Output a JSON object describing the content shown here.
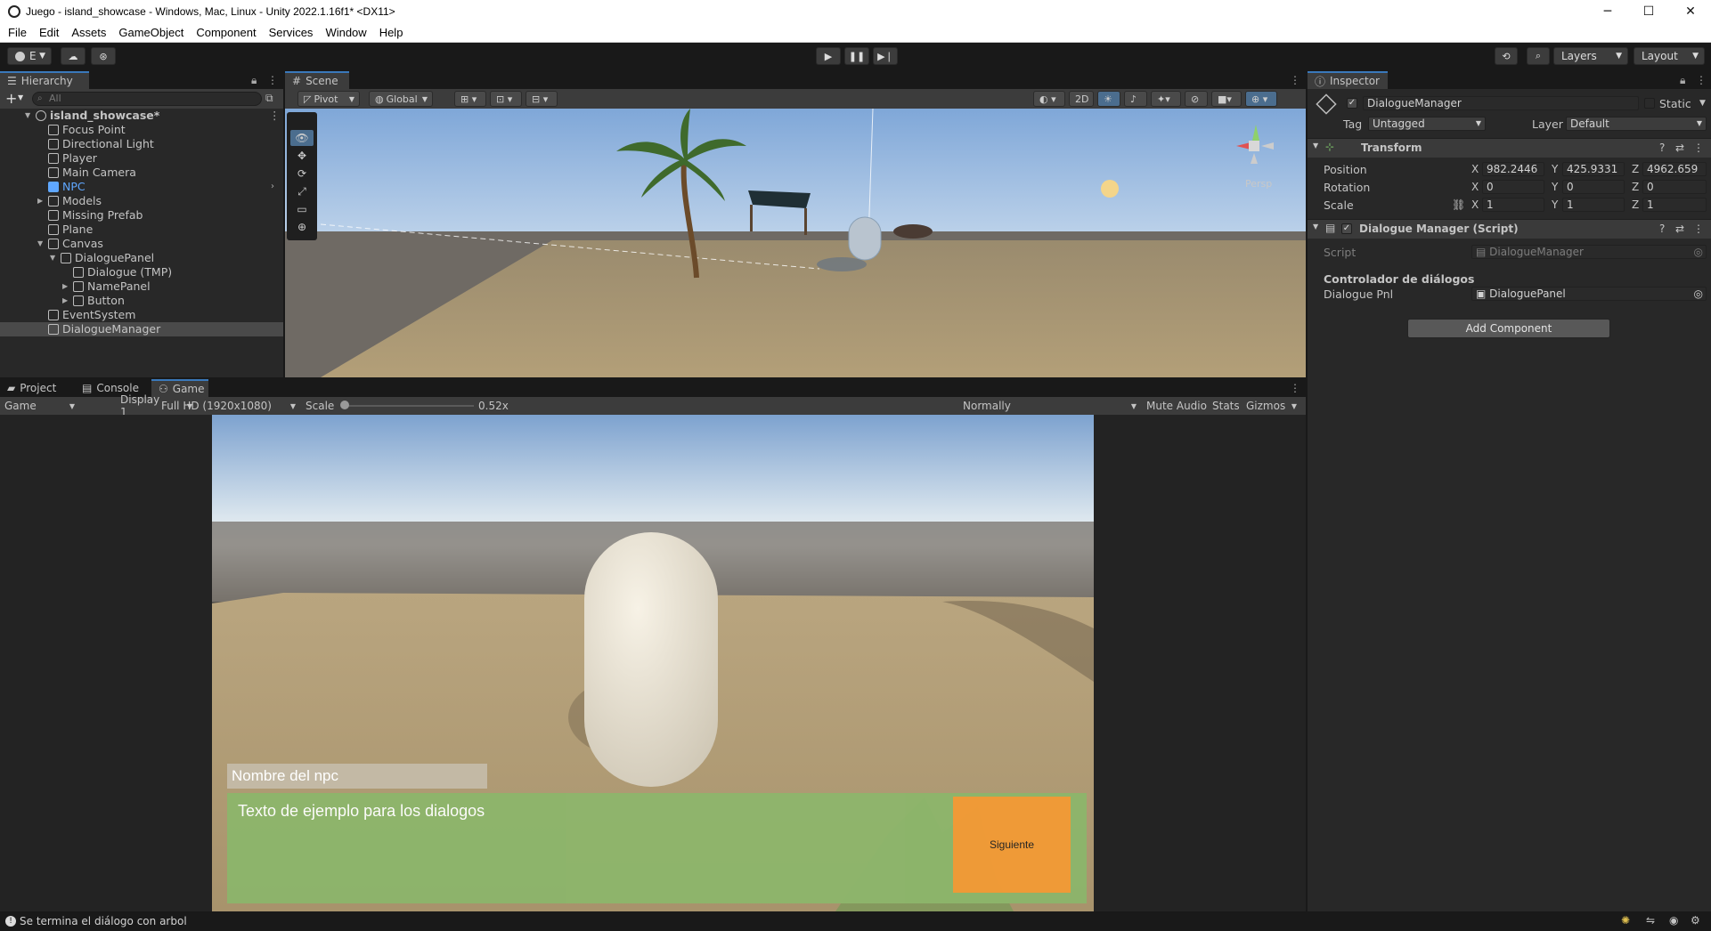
{
  "window": {
    "title": "Juego - island_showcase - Windows, Mac, Linux - Unity 2022.1.16f1* <DX11>",
    "controls": {
      "minimize": "─",
      "maximize": "☐",
      "close": "✕"
    }
  },
  "menu": [
    "File",
    "Edit",
    "Assets",
    "GameObject",
    "Component",
    "Services",
    "Window",
    "Help"
  ],
  "toolbar": {
    "account_label": "E",
    "layers_label": "Layers",
    "layout_label": "Layout"
  },
  "hierarchy": {
    "tab_label": "Hierarchy",
    "search_placeholder": "All",
    "items": [
      {
        "label": "island_showcase*",
        "depth": 0,
        "fold": "open",
        "kind": "scene"
      },
      {
        "label": "Focus Point",
        "depth": 1,
        "fold": "none",
        "kind": "object"
      },
      {
        "label": "Directional Light",
        "depth": 1,
        "fold": "none",
        "kind": "object"
      },
      {
        "label": "Player",
        "depth": 1,
        "fold": "none",
        "kind": "object"
      },
      {
        "label": "Main Camera",
        "depth": 1,
        "fold": "none",
        "kind": "object"
      },
      {
        "label": "NPC",
        "depth": 1,
        "fold": "none",
        "kind": "prefab"
      },
      {
        "label": "Models",
        "depth": 1,
        "fold": "closed",
        "kind": "object"
      },
      {
        "label": "Missing Prefab",
        "depth": 1,
        "fold": "none",
        "kind": "object"
      },
      {
        "label": "Plane",
        "depth": 1,
        "fold": "none",
        "kind": "object"
      },
      {
        "label": "Canvas",
        "depth": 1,
        "fold": "open",
        "kind": "object"
      },
      {
        "label": "DialoguePanel",
        "depth": 2,
        "fold": "open",
        "kind": "object"
      },
      {
        "label": "Dialogue (TMP)",
        "depth": 3,
        "fold": "none",
        "kind": "object"
      },
      {
        "label": "NamePanel",
        "depth": 3,
        "fold": "closed",
        "kind": "object"
      },
      {
        "label": "Button",
        "depth": 3,
        "fold": "closed",
        "kind": "object"
      },
      {
        "label": "EventSystem",
        "depth": 1,
        "fold": "none",
        "kind": "object"
      },
      {
        "label": "DialogueManager",
        "depth": 1,
        "fold": "none",
        "kind": "object",
        "selected": true
      }
    ]
  },
  "scene": {
    "tab_label": "Scene",
    "pivot_label": "Pivot",
    "global_label": "Global",
    "mode_2d_label": "2D",
    "persp_label": "Persp"
  },
  "inspector": {
    "tab_label": "Inspector",
    "object_name": "DialogueManager",
    "static_label": "Static",
    "tag_label": "Tag",
    "tag_value": "Untagged",
    "layer_label": "Layer",
    "layer_value": "Default",
    "transform": {
      "title": "Transform",
      "position_label": "Position",
      "rotation_label": "Rotation",
      "scale_label": "Scale",
      "position": {
        "x": "982.2446",
        "y": "425.9331",
        "z": "4962.659"
      },
      "rotation": {
        "x": "0",
        "y": "0",
        "z": "0"
      },
      "scale": {
        "x": "1",
        "y": "1",
        "z": "1"
      },
      "axis_x": "X",
      "axis_y": "Y",
      "axis_z": "Z"
    },
    "script_component": {
      "title": "Dialogue Manager (Script)",
      "script_label": "Script",
      "script_value": "DialogueManager",
      "section_header": "Controlador de diálogos",
      "field_label": "Dialogue Pnl",
      "field_value": "DialoguePanel"
    },
    "add_component_label": "Add Component"
  },
  "bottom_tabs": {
    "project": "Project",
    "console": "Console",
    "game": "Game"
  },
  "game_toolbar": {
    "mode": "Game",
    "display": "Display 1",
    "resolution": "Full HD (1920x1080)",
    "scale_label": "Scale",
    "scale_value": "0.52x",
    "scale_fraction": 0.0,
    "play_focus": "Normally",
    "mute_label": "Mute Audio",
    "stats_label": "Stats",
    "gizmos_label": "Gizmos"
  },
  "game_ui": {
    "npc_name": "Nombre del npc",
    "dialogue_text": "Texto de ejemplo para los dialogos",
    "next_button": "Siguiente"
  },
  "status": {
    "message": "Se termina el diálogo con arbol"
  },
  "colors": {
    "accent": "#3a79bb",
    "prefab": "#5fa7ff",
    "dialogue_panel": "#8db56b",
    "next_button": "#f29b36",
    "name_panel": "#c3b9a5"
  }
}
